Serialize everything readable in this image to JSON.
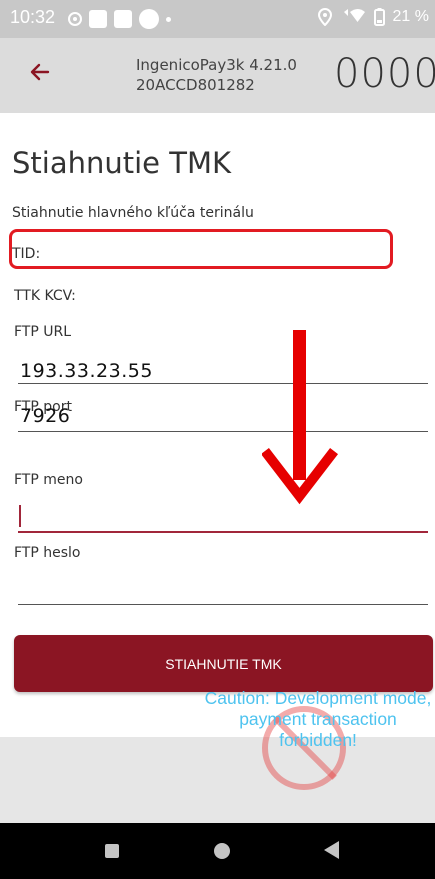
{
  "status_bar": {
    "time": "10:32",
    "battery": "21 %"
  },
  "header": {
    "app_name": "IngenicoPay3k 4.21.0",
    "terminal_id": "20ACCD801282",
    "counter": "0000"
  },
  "page": {
    "title": "Stiahnutie TMK",
    "subtitle": "Stiahnutie hlavného kľúča terinálu",
    "tid_label": "TID:",
    "ttk_kcv_label": "TTK KCV:"
  },
  "form": {
    "ftp_url_label": "FTP URL",
    "ftp_url_value": "193.33.23.55",
    "ftp_port_label": "FTP port",
    "ftp_port_value": "7926",
    "ftp_name_label": "FTP meno",
    "ftp_name_value": "",
    "ftp_password_label": "FTP heslo",
    "ftp_password_value": ""
  },
  "actions": {
    "download_button": "STIAHNUTIE TMK"
  },
  "warning": {
    "text": "Caution: Development mode, payment transaction forbidden!"
  },
  "colors": {
    "accent": "#8b1523",
    "highlight": "#e21b22",
    "warning_text": "#4ec3ef"
  }
}
